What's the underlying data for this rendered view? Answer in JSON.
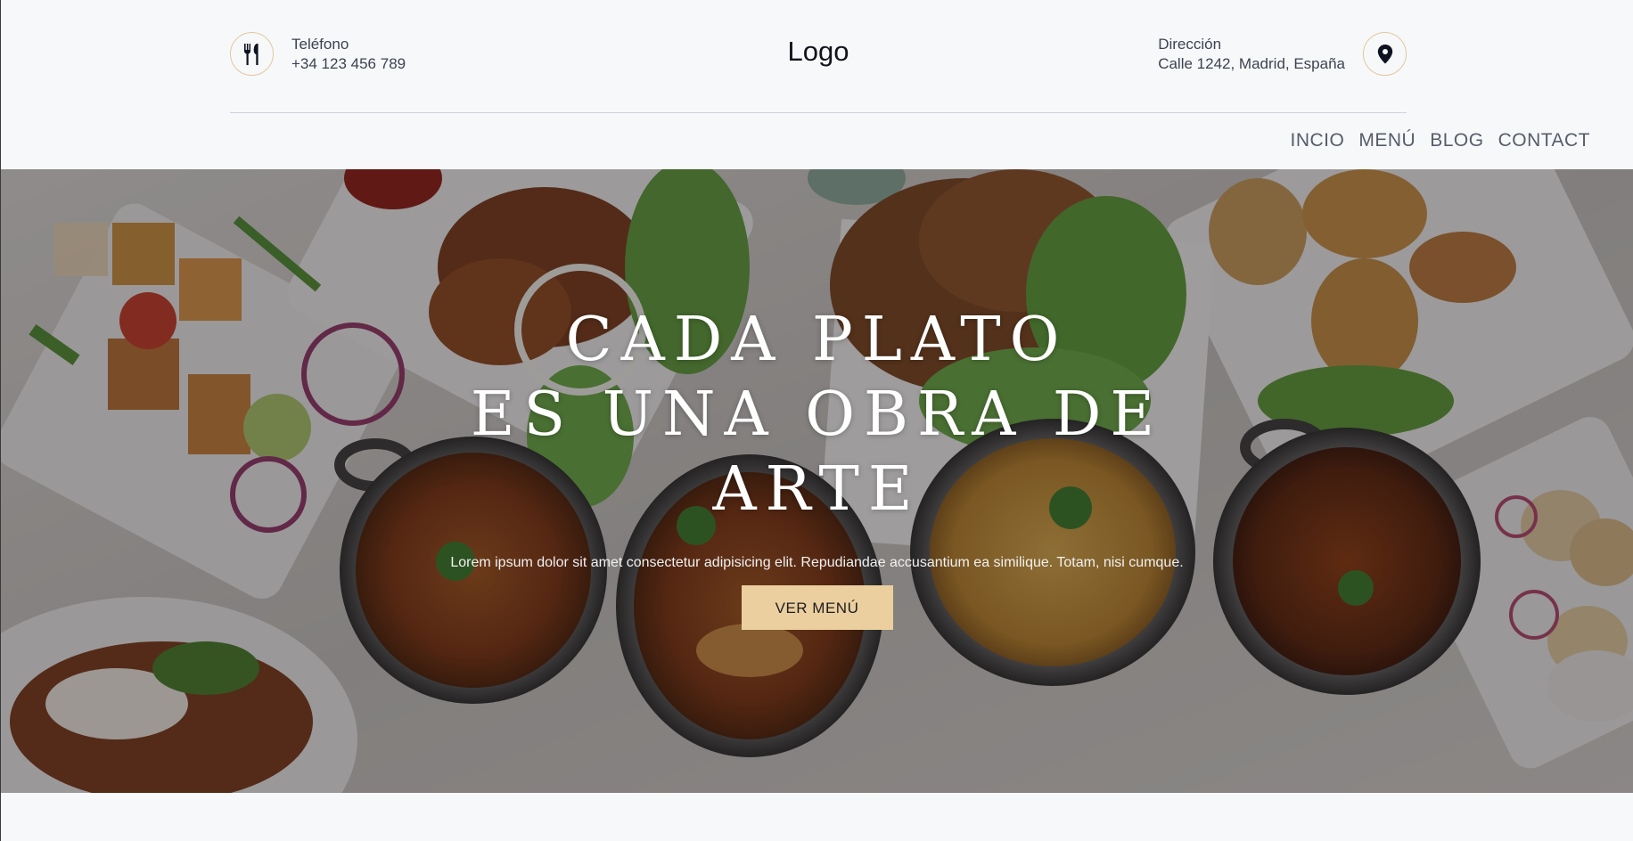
{
  "header": {
    "phone_label": "Teléfono",
    "phone_number": "+34 123 456 789",
    "logo": "Logo",
    "address_label": "Dirección",
    "address_value": "Calle 1242, Madrid, España",
    "phone_icon": "fork-knife-icon",
    "address_icon": "map-pin-icon"
  },
  "nav": {
    "items": [
      "INCIO",
      "MENÚ",
      "BLOG",
      "CONTACT"
    ]
  },
  "hero": {
    "title_lines": [
      "CADA PLATO",
      "ES UNA OBRA DE",
      "ARTE"
    ],
    "text": "Lorem ipsum dolor sit amet consectetur adipisicing elit. Repudiandae accusantium ea similique. Totam, nisi cumque.",
    "button_label": "VER MENÚ",
    "background": "food-table-photo"
  },
  "colors": {
    "accent": "#eccf9e",
    "icon_border": "#e3c89c",
    "page_bg": "#f7f8fa"
  }
}
